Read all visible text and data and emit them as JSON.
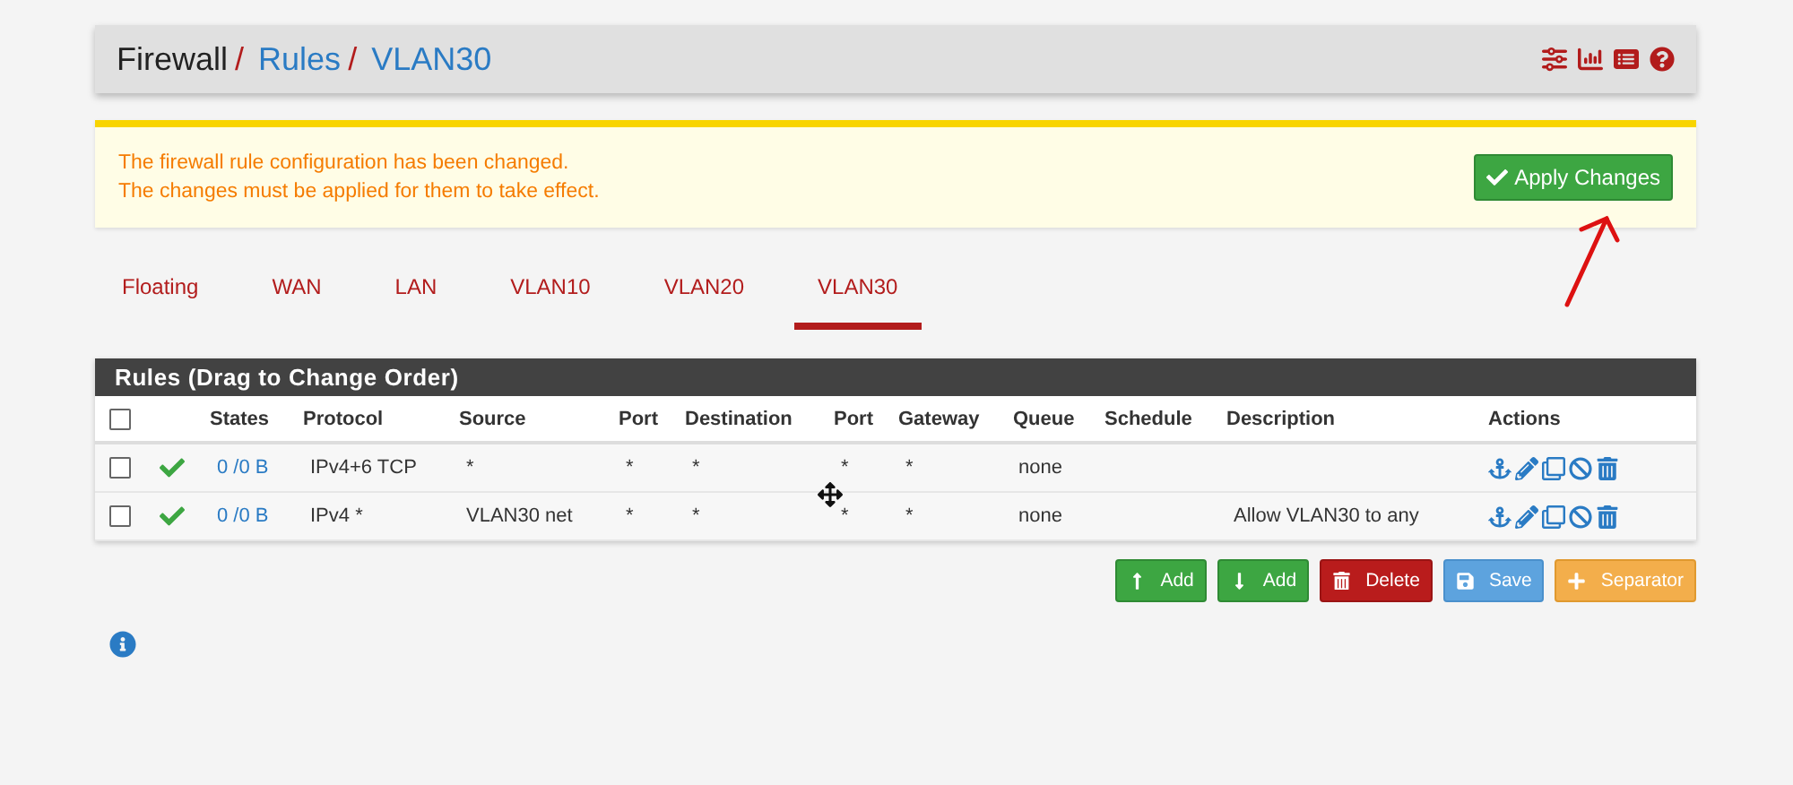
{
  "breadcrumb_separator": "/",
  "breadcrumb": [
    {
      "label": "Firewall",
      "link": false
    },
    {
      "label": "Rules",
      "link": true
    },
    {
      "label": "VLAN30",
      "link": true
    }
  ],
  "alert": {
    "lines": [
      "The firewall rule configuration has been changed.",
      "The changes must be applied for them to take effect."
    ],
    "button": "Apply Changes"
  },
  "tabs": [
    {
      "label": "Floating",
      "selected": false
    },
    {
      "label": "WAN",
      "selected": false
    },
    {
      "label": "LAN",
      "selected": false
    },
    {
      "label": "VLAN10",
      "selected": false
    },
    {
      "label": "VLAN20",
      "selected": false
    },
    {
      "label": "VLAN30",
      "selected": true
    }
  ],
  "table": {
    "title": "Rules (Drag to Change Order)",
    "select_all_checked": false,
    "columns": [
      "States",
      "Protocol",
      "Source",
      "Port",
      "Destination",
      "Port",
      "Gateway",
      "Queue",
      "Schedule",
      "Description",
      "Actions"
    ],
    "rows": [
      {
        "checked": false,
        "enabled": true,
        "states": "0 /0 B",
        "protocol": "IPv4+6 TCP",
        "source": "*",
        "source_port": "*",
        "destination": "*",
        "destination_port": "*",
        "gateway": "*",
        "queue": "none",
        "description": ""
      },
      {
        "checked": false,
        "enabled": true,
        "states": "0 /0 B",
        "protocol": "IPv4 *",
        "source": "VLAN30 net",
        "source_port": "*",
        "destination": "*",
        "destination_port": "*",
        "gateway": "*",
        "queue": "none",
        "description": "Allow VLAN30 to any"
      }
    ]
  },
  "buttons": [
    {
      "kind": "add-top",
      "label": "Add"
    },
    {
      "kind": "add-bottom",
      "label": "Add"
    },
    {
      "kind": "delete",
      "label": "Delete"
    },
    {
      "kind": "save",
      "label": "Save"
    },
    {
      "kind": "separator",
      "label": "Separator"
    }
  ]
}
